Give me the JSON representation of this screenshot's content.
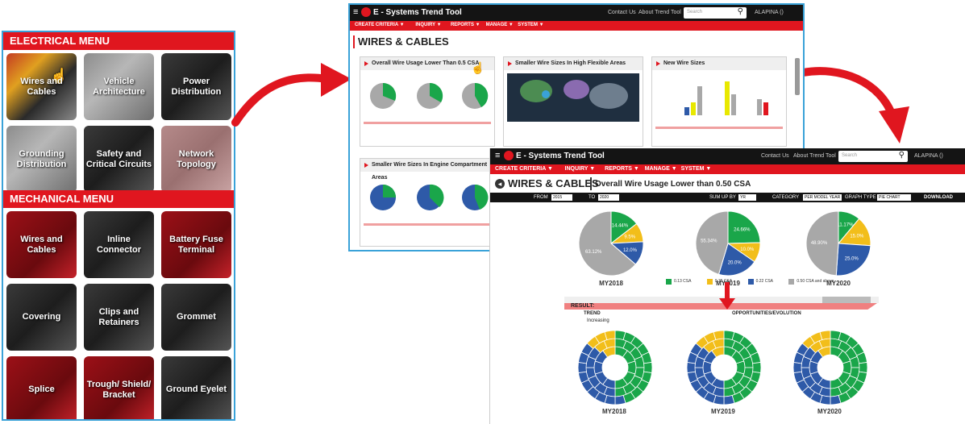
{
  "left_panel": {
    "electrical_header": "ELECTRICAL MENU",
    "mechanical_header": "MECHANICAL MENU",
    "electrical_tiles": [
      "Wires and Cables",
      "Vehicle Architecture",
      "Power Distribution",
      "Grounding Distribution",
      "Safety and Critical Circuits",
      "Network Topology"
    ],
    "mechanical_tiles": [
      "Wires and Cables",
      "Inline Connector",
      "Battery Fuse Terminal",
      "Covering",
      "Clips and Retainers",
      "Grommet",
      "Splice",
      "Trough/ Shield/ Bracket",
      "Ground Eyelet"
    ]
  },
  "mid_window": {
    "app_title": "E - Systems Trend Tool",
    "contact": "Contact Us",
    "about": "About Trend Tool",
    "search_placeholder": "Search",
    "user": "ALAPINA ()",
    "menu": [
      "CREATE CRITERIA ▼",
      "INQUIRY ▼",
      "REPORTS ▼",
      "MANAGE ▼",
      "SYSTEM ▼"
    ],
    "page_title": "WIRES & CABLES",
    "panels": [
      "Overall Wire Usage Lower Than 0.5 CSA",
      "Smaller Wire Sizes In High Flexible Areas",
      "New Wire Sizes",
      "Smaller Wire Sizes In Engine Compartment Areas"
    ]
  },
  "right_window": {
    "app_title": "E - Systems Trend Tool",
    "contact": "Contact Us",
    "about": "About Trend Tool",
    "search_placeholder": "Search",
    "user": "ALAPINA ()",
    "menu": [
      "CREATE CRITERIA ▼",
      "INQUIRY ▼",
      "REPORTS ▼",
      "MANAGE ▼",
      "SYSTEM ▼"
    ],
    "page_title": "WIRES & CABLES",
    "subtitle": "Overall Wire Usage Lower than 0.50 CSA",
    "from_label": "FROM",
    "from_value": "2015",
    "to_label": "TO",
    "to_value": "2020",
    "sum_label": "SUM UP BY",
    "sum_value": "YR",
    "category_label": "CATEGORY",
    "category_value": "PER MODEL YEAR",
    "graph_label": "GRAPH TYPE",
    "graph_value": "PIE CHART",
    "download": "DOWNLOAD",
    "result_label": "RESULT:",
    "trend_label": "TREND",
    "trend_item": "Increasing",
    "opps_label": "OPPORTUNITIES/EVOLUTION",
    "legend": [
      "0.13 CSA",
      "0.35 CSA",
      "0.22 CSA",
      "0.50 CSA and above"
    ]
  },
  "chart_data": [
    {
      "type": "pie",
      "categories": [
        "0.13 CSA",
        "0.35 CSA",
        "0.22 CSA",
        "0.50 CSA and above"
      ],
      "colors": [
        "#1aa64a",
        "#f2be1a",
        "#2e5aa8",
        "#a8a8a8"
      ],
      "series": [
        {
          "name": "MY2018",
          "values": [
            14.4,
            9.5,
            12.0,
            63.1
          ]
        },
        {
          "name": "MY2019",
          "values": [
            24.6,
            10.0,
            20.0,
            45.34
          ]
        },
        {
          "name": "MY2020",
          "values": [
            11.1,
            15.0,
            25.0,
            48.9
          ]
        }
      ],
      "labels": [
        [
          "14.44%",
          "9.5%",
          "12.0%",
          "63.12%"
        ],
        [
          "24.66%",
          "10.0%",
          "20.0%",
          "55.34%"
        ],
        [
          "11.17%",
          "15.0%",
          "25.0%",
          "48.90%"
        ]
      ]
    }
  ],
  "year_labels": [
    "MY2018",
    "MY2019",
    "MY2020"
  ]
}
